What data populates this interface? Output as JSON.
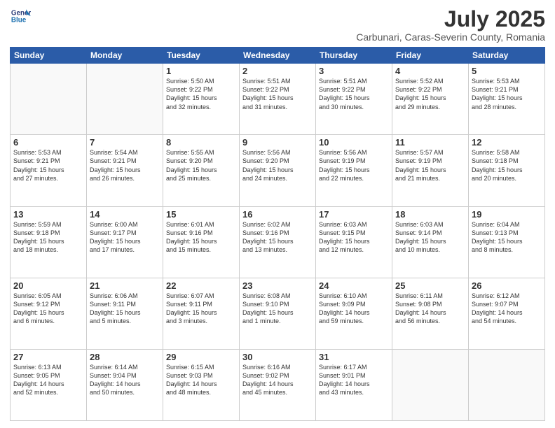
{
  "header": {
    "logo_line1": "General",
    "logo_line2": "Blue",
    "month": "July 2025",
    "location": "Carbunari, Caras-Severin County, Romania"
  },
  "weekdays": [
    "Sunday",
    "Monday",
    "Tuesday",
    "Wednesday",
    "Thursday",
    "Friday",
    "Saturday"
  ],
  "weeks": [
    [
      {
        "day": "",
        "info": ""
      },
      {
        "day": "",
        "info": ""
      },
      {
        "day": "1",
        "info": "Sunrise: 5:50 AM\nSunset: 9:22 PM\nDaylight: 15 hours\nand 32 minutes."
      },
      {
        "day": "2",
        "info": "Sunrise: 5:51 AM\nSunset: 9:22 PM\nDaylight: 15 hours\nand 31 minutes."
      },
      {
        "day": "3",
        "info": "Sunrise: 5:51 AM\nSunset: 9:22 PM\nDaylight: 15 hours\nand 30 minutes."
      },
      {
        "day": "4",
        "info": "Sunrise: 5:52 AM\nSunset: 9:22 PM\nDaylight: 15 hours\nand 29 minutes."
      },
      {
        "day": "5",
        "info": "Sunrise: 5:53 AM\nSunset: 9:21 PM\nDaylight: 15 hours\nand 28 minutes."
      }
    ],
    [
      {
        "day": "6",
        "info": "Sunrise: 5:53 AM\nSunset: 9:21 PM\nDaylight: 15 hours\nand 27 minutes."
      },
      {
        "day": "7",
        "info": "Sunrise: 5:54 AM\nSunset: 9:21 PM\nDaylight: 15 hours\nand 26 minutes."
      },
      {
        "day": "8",
        "info": "Sunrise: 5:55 AM\nSunset: 9:20 PM\nDaylight: 15 hours\nand 25 minutes."
      },
      {
        "day": "9",
        "info": "Sunrise: 5:56 AM\nSunset: 9:20 PM\nDaylight: 15 hours\nand 24 minutes."
      },
      {
        "day": "10",
        "info": "Sunrise: 5:56 AM\nSunset: 9:19 PM\nDaylight: 15 hours\nand 22 minutes."
      },
      {
        "day": "11",
        "info": "Sunrise: 5:57 AM\nSunset: 9:19 PM\nDaylight: 15 hours\nand 21 minutes."
      },
      {
        "day": "12",
        "info": "Sunrise: 5:58 AM\nSunset: 9:18 PM\nDaylight: 15 hours\nand 20 minutes."
      }
    ],
    [
      {
        "day": "13",
        "info": "Sunrise: 5:59 AM\nSunset: 9:18 PM\nDaylight: 15 hours\nand 18 minutes."
      },
      {
        "day": "14",
        "info": "Sunrise: 6:00 AM\nSunset: 9:17 PM\nDaylight: 15 hours\nand 17 minutes."
      },
      {
        "day": "15",
        "info": "Sunrise: 6:01 AM\nSunset: 9:16 PM\nDaylight: 15 hours\nand 15 minutes."
      },
      {
        "day": "16",
        "info": "Sunrise: 6:02 AM\nSunset: 9:16 PM\nDaylight: 15 hours\nand 13 minutes."
      },
      {
        "day": "17",
        "info": "Sunrise: 6:03 AM\nSunset: 9:15 PM\nDaylight: 15 hours\nand 12 minutes."
      },
      {
        "day": "18",
        "info": "Sunrise: 6:03 AM\nSunset: 9:14 PM\nDaylight: 15 hours\nand 10 minutes."
      },
      {
        "day": "19",
        "info": "Sunrise: 6:04 AM\nSunset: 9:13 PM\nDaylight: 15 hours\nand 8 minutes."
      }
    ],
    [
      {
        "day": "20",
        "info": "Sunrise: 6:05 AM\nSunset: 9:12 PM\nDaylight: 15 hours\nand 6 minutes."
      },
      {
        "day": "21",
        "info": "Sunrise: 6:06 AM\nSunset: 9:11 PM\nDaylight: 15 hours\nand 5 minutes."
      },
      {
        "day": "22",
        "info": "Sunrise: 6:07 AM\nSunset: 9:11 PM\nDaylight: 15 hours\nand 3 minutes."
      },
      {
        "day": "23",
        "info": "Sunrise: 6:08 AM\nSunset: 9:10 PM\nDaylight: 15 hours\nand 1 minute."
      },
      {
        "day": "24",
        "info": "Sunrise: 6:10 AM\nSunset: 9:09 PM\nDaylight: 14 hours\nand 59 minutes."
      },
      {
        "day": "25",
        "info": "Sunrise: 6:11 AM\nSunset: 9:08 PM\nDaylight: 14 hours\nand 56 minutes."
      },
      {
        "day": "26",
        "info": "Sunrise: 6:12 AM\nSunset: 9:07 PM\nDaylight: 14 hours\nand 54 minutes."
      }
    ],
    [
      {
        "day": "27",
        "info": "Sunrise: 6:13 AM\nSunset: 9:05 PM\nDaylight: 14 hours\nand 52 minutes."
      },
      {
        "day": "28",
        "info": "Sunrise: 6:14 AM\nSunset: 9:04 PM\nDaylight: 14 hours\nand 50 minutes."
      },
      {
        "day": "29",
        "info": "Sunrise: 6:15 AM\nSunset: 9:03 PM\nDaylight: 14 hours\nand 48 minutes."
      },
      {
        "day": "30",
        "info": "Sunrise: 6:16 AM\nSunset: 9:02 PM\nDaylight: 14 hours\nand 45 minutes."
      },
      {
        "day": "31",
        "info": "Sunrise: 6:17 AM\nSunset: 9:01 PM\nDaylight: 14 hours\nand 43 minutes."
      },
      {
        "day": "",
        "info": ""
      },
      {
        "day": "",
        "info": ""
      }
    ]
  ]
}
